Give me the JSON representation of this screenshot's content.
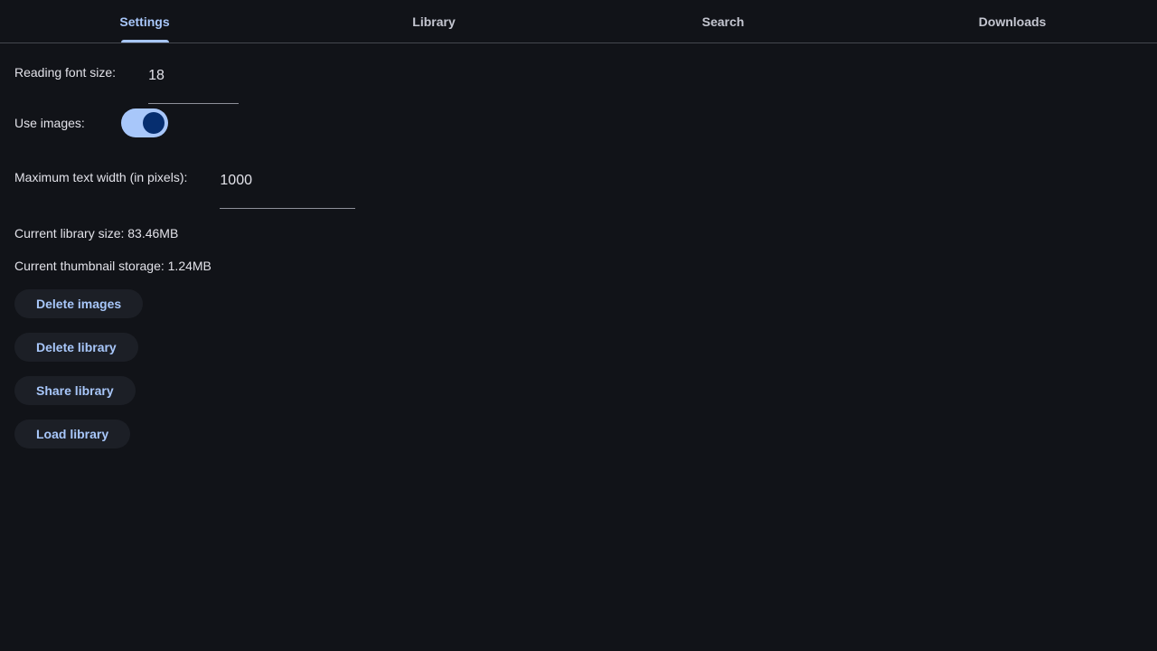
{
  "tabs": [
    {
      "label": "Settings",
      "active": true
    },
    {
      "label": "Library",
      "active": false
    },
    {
      "label": "Search",
      "active": false
    },
    {
      "label": "Downloads",
      "active": false
    }
  ],
  "settings": {
    "font_size_label": "Reading font size:",
    "font_size_value": "18",
    "use_images_label": "Use images:",
    "use_images_on": true,
    "max_width_label": "Maximum text width (in pixels):",
    "max_width_value": "1000",
    "library_size": "Current library size: 83.46MB",
    "thumbnail_storage": "Current thumbnail storage: 1.24MB"
  },
  "buttons": {
    "delete_images": "Delete images",
    "delete_library": "Delete library",
    "share_library": "Share library",
    "load_library": "Load library"
  },
  "colors": {
    "background": "#111318",
    "accent": "#a8c7fa",
    "button_bg": "#1c1f26",
    "divider": "#44474e"
  }
}
